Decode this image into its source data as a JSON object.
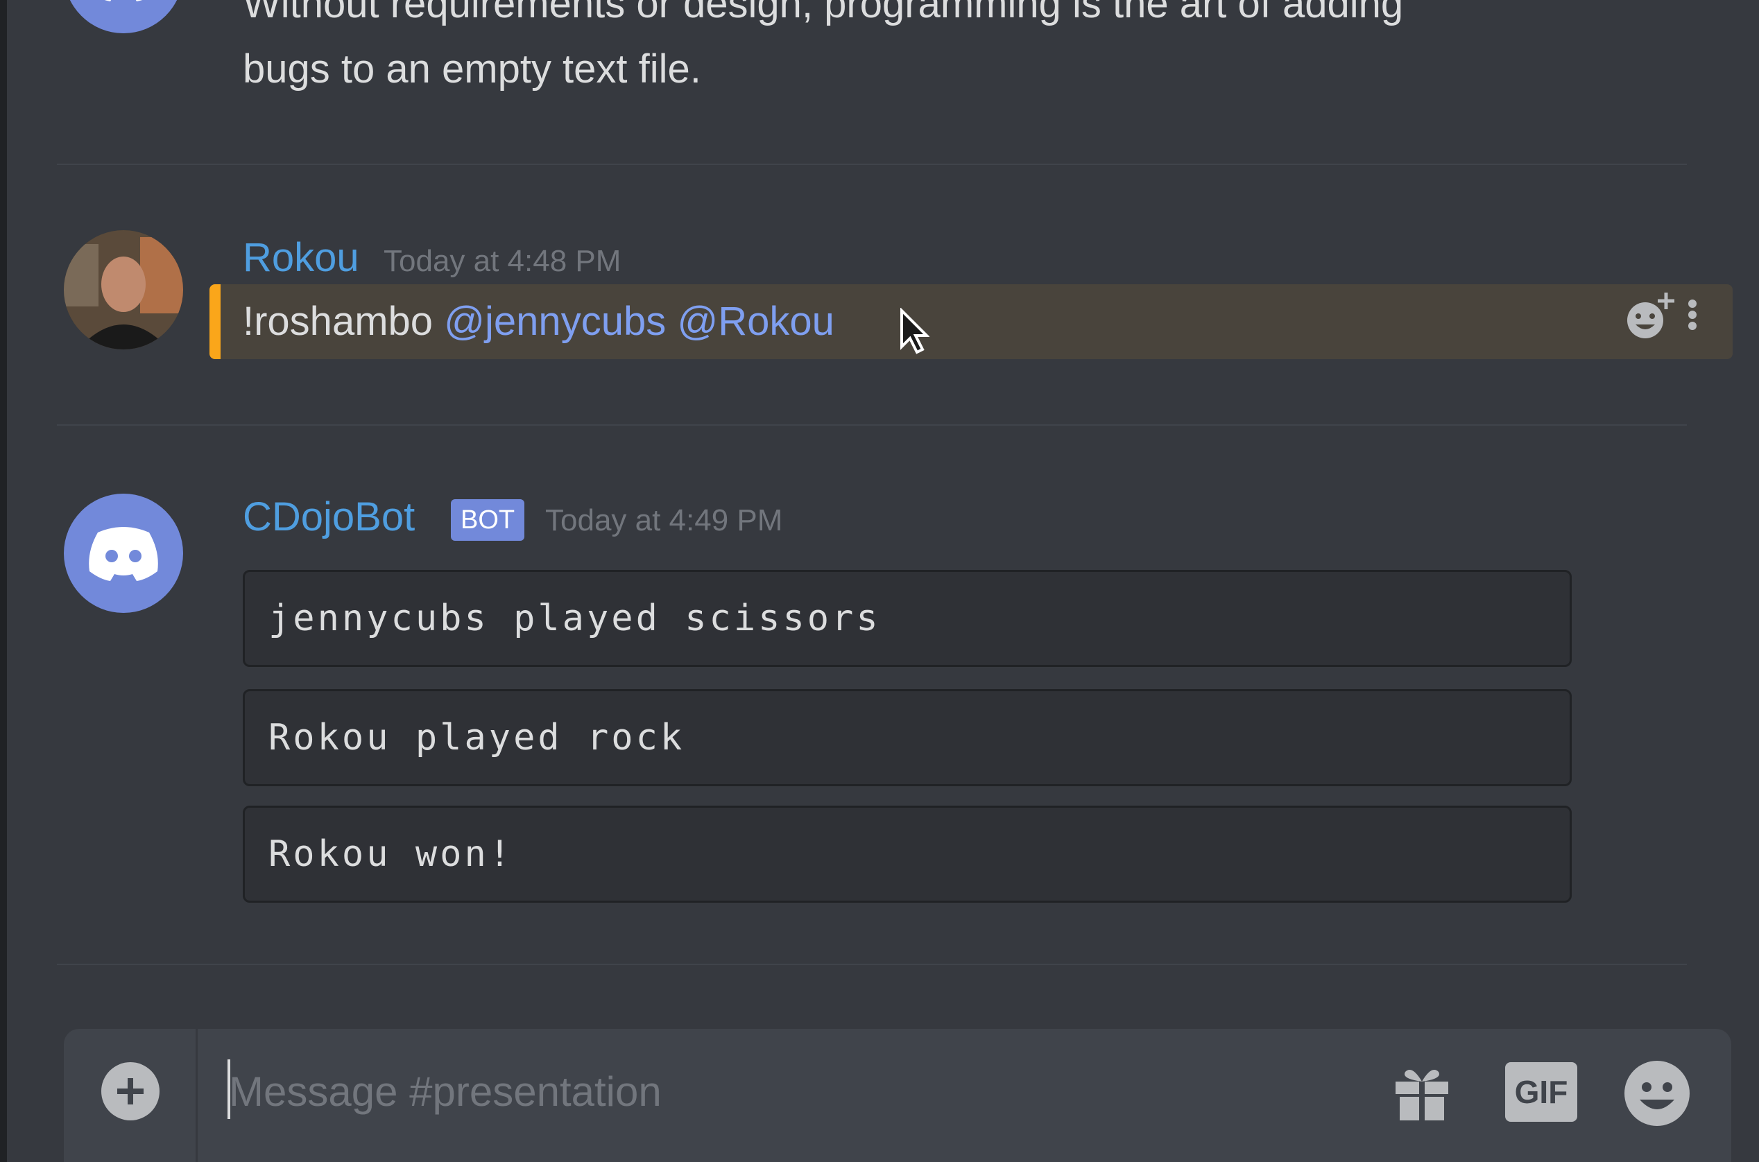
{
  "previous_message": {
    "text_line1": "Without requirements or design, programming is the art of adding",
    "text_line2": "bugs to an empty text file."
  },
  "message_rokou": {
    "username": "Rokou",
    "timestamp": "Today at 4:48 PM",
    "text": "!roshambo",
    "mention1": "@jennycubs",
    "mention2": "@Rokou"
  },
  "message_bot": {
    "username": "CDojoBot",
    "tag": "BOT",
    "timestamp": "Today at 4:49 PM",
    "code_blocks": [
      "jennycubs played scissors",
      "Rokou played rock",
      "Rokou won!"
    ]
  },
  "composer": {
    "placeholder": "Message #presentation",
    "gif_label": "GIF"
  },
  "colors": {
    "background": "#36393f",
    "username": "#4f9ee0",
    "mention": "#7f9ff0",
    "highlight_bar": "#faa61a",
    "bot_tag": "#7289da"
  },
  "icons": {
    "add": "plus-circle-icon",
    "gift": "gift-icon",
    "gif": "gif-icon",
    "emoji": "smile-icon",
    "add_reaction": "add-reaction-icon",
    "more": "more-vertical-icon"
  }
}
